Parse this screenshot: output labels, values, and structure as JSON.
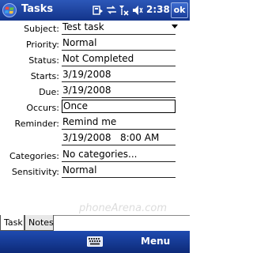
{
  "window": {
    "title": "Tasks",
    "clock": "2:38",
    "ok_label": "ok",
    "status_icons": [
      "sync-icon",
      "connectivity-icon",
      "signal-icon",
      "volume-icon"
    ]
  },
  "form": {
    "subject": {
      "label": "Subject:",
      "value": "Test task"
    },
    "priority": {
      "label": "Priority:",
      "value": "Normal"
    },
    "status": {
      "label": "Status:",
      "value": "Not Completed"
    },
    "starts": {
      "label": "Starts:",
      "value": "3/19/2008"
    },
    "due": {
      "label": "Due:",
      "value": "3/19/2008"
    },
    "occurs": {
      "label": "Occurs:",
      "value": "Once"
    },
    "reminder": {
      "label": "Reminder:",
      "value": "Remind me",
      "datetime": "3/19/2008   8:00 AM"
    },
    "categories": {
      "label": "Categories:",
      "value": "No categories..."
    },
    "sensitivity": {
      "label": "Sensitivity:",
      "value": "Normal"
    }
  },
  "tabs": [
    {
      "label": "Task"
    },
    {
      "label": "Notes"
    }
  ],
  "watermark": "phoneArena.com",
  "menubar": {
    "keyboard_icon": "keyboard-icon",
    "menu_label": "Menu"
  }
}
